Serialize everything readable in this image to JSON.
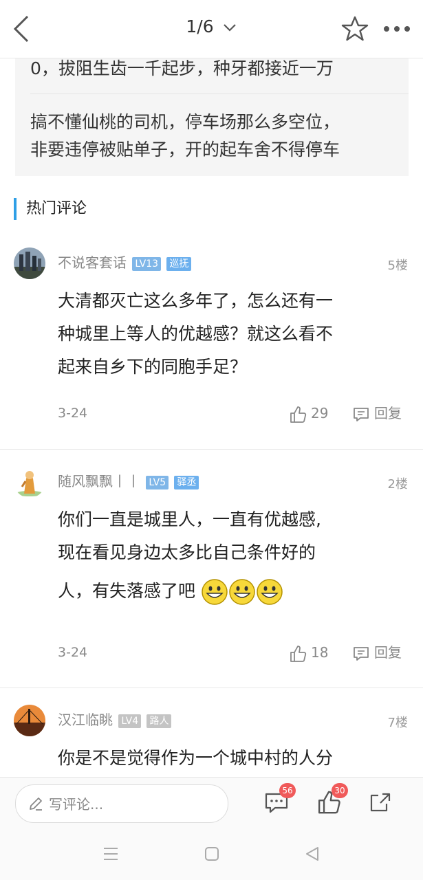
{
  "header": {
    "page_indicator": "1/6",
    "icons": {
      "back": "chevron-left-icon",
      "favorite": "star-icon",
      "more": "more-icon"
    }
  },
  "quoted_comments": [
    "0，拔阻生齿一千起步，种牙都接近一万",
    "搞不懂仙桃的司机，停车场那么多空位，",
    "非要违停被贴单子，开的起车舍不得停车"
  ],
  "section": {
    "title": "热门评论"
  },
  "comments": [
    {
      "user": "不说客套话",
      "level": "LV13",
      "title_badge": "巡抚",
      "floor": "5楼",
      "lines": [
        "大清都灭亡这么多年了，怎么还有一",
        "种城里上等人的优越感？就这么看不",
        "起来自乡下的同胞手足？"
      ],
      "date": "3-24",
      "likes": "29",
      "reply_label": "回复"
    },
    {
      "user": "随风飘飘丨丨",
      "level": "LV5",
      "title_badge": "驿丞",
      "floor": "2楼",
      "lines": [
        "你们一直是城里人，一直有优越感,",
        "现在看见身边太多比自己条件好的",
        "人，有失落感了吧"
      ],
      "date": "3-24",
      "likes": "18",
      "reply_label": "回复"
    },
    {
      "user": "汉江临眺",
      "level": "LV4",
      "title_badge": "路人",
      "floor": "7楼",
      "lines": [
        "你是不是觉得作为一个城中村的人分"
      ]
    }
  ],
  "colors": {
    "accent": "#2e9fe6",
    "level_badge": "#7fb6e8",
    "title_badge": "#6cb0ee",
    "gray_badge": "#c4c4c4",
    "count_bubble": "#f05a5a"
  },
  "bottom_bar": {
    "write_placeholder": "写评论...",
    "comment_count": "56",
    "like_count": "30",
    "icons": {
      "pen": "pen-icon",
      "comment": "comment-icon",
      "like": "thumbs-up-icon",
      "share": "share-icon"
    }
  },
  "nav_bar": {
    "icons": [
      "menu-icon",
      "home-icon",
      "back-icon"
    ]
  }
}
